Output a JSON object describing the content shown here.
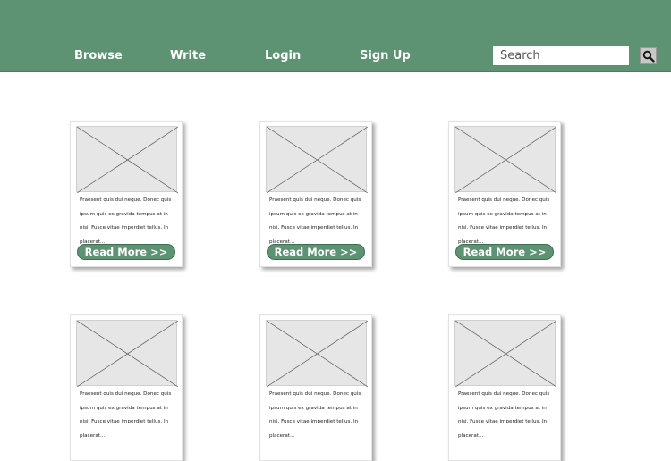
{
  "nav": {
    "items": [
      {
        "label": "Browse"
      },
      {
        "label": "Write"
      },
      {
        "label": "Login"
      },
      {
        "label": "Sign Up"
      }
    ]
  },
  "search": {
    "placeholder": "Search",
    "button_icon": "search-icon"
  },
  "colors": {
    "header_bg": "#5d9373",
    "button_bg": "#5d9373"
  },
  "cards": [
    {
      "excerpt": "Praesent quis dui neque. Donec quis ipsum quis ex gravida tempus at in nisi. Fusce vitae imperdiet tellus. In placerat...",
      "button": "Read More >>"
    },
    {
      "excerpt": "Praesent quis dui neque. Donec quis ipsum quis ex gravida tempus at in nisi. Fusce vitae imperdiet tellus. In placerat...",
      "button": "Read More >>"
    },
    {
      "excerpt": "Praesent quis dui neque. Donec quis ipsum quis ex gravida tempus at in nisi. Fusce vitae imperdiet tellus. In placerat...",
      "button": "Read More >>"
    },
    {
      "excerpt": "Praesent quis dui neque. Donec quis ipsum quis ex gravida tempus at in nisi. Fusce vitae imperdiet tellus. In placerat...",
      "button": ""
    },
    {
      "excerpt": "Praesent quis dui neque. Donec quis ipsum quis ex gravida tempus at in nisi. Fusce vitae imperdiet tellus. In placerat...",
      "button": ""
    },
    {
      "excerpt": "Praesent quis dui neque. Donec quis ipsum quis ex gravida tempus at in nisi. Fusce vitae imperdiet tellus. In placerat...",
      "button": ""
    }
  ]
}
